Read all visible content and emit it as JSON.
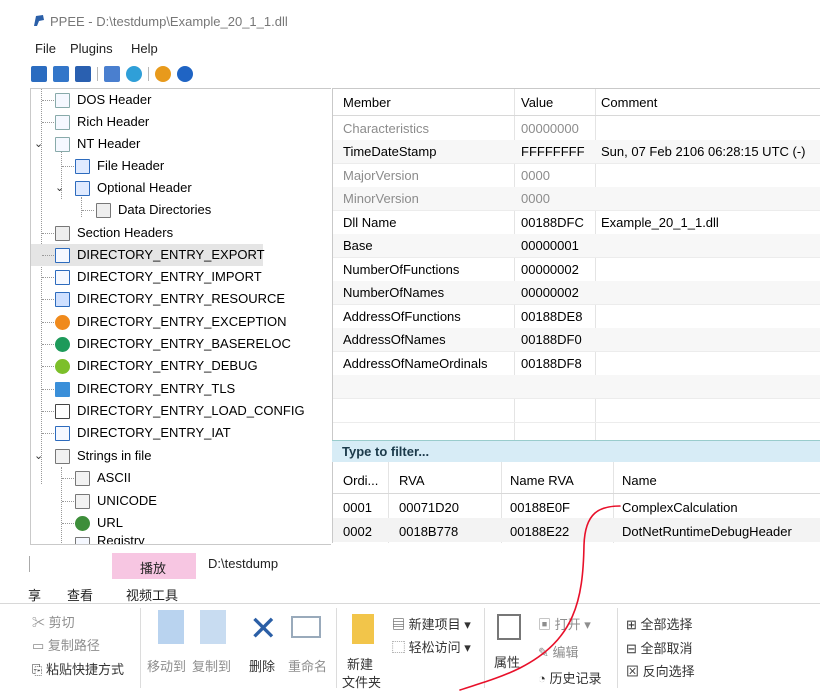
{
  "window": {
    "title": "PPEE - D:\\testdump\\Example_20_1_1.dll"
  },
  "menu": [
    "File",
    "Plugins",
    "Help"
  ],
  "toolbar_icons": [
    "open-folder-icon",
    "save-icon",
    "save-all-icon",
    "hex-icon",
    "refresh-icon",
    "plugin-icon",
    "help-icon"
  ],
  "tree": {
    "items": [
      {
        "label": "DOS Header",
        "icon": "document-icon"
      },
      {
        "label": "Rich Header",
        "icon": "document-icon"
      },
      {
        "label": "NT Header",
        "icon": "document-icon",
        "expanded": true
      },
      {
        "label": "File Header",
        "icon": "table-icon"
      },
      {
        "label": "Optional Header",
        "icon": "table-icon",
        "expanded": true
      },
      {
        "label": "Data Directories",
        "icon": "grid-icon"
      },
      {
        "label": "Section Headers",
        "icon": "grid-icon"
      },
      {
        "label": "DIRECTORY_ENTRY_EXPORT",
        "icon": "export-icon",
        "selected": true
      },
      {
        "label": "DIRECTORY_ENTRY_IMPORT",
        "icon": "import-icon"
      },
      {
        "label": "DIRECTORY_ENTRY_RESOURCE",
        "icon": "resource-icon"
      },
      {
        "label": "DIRECTORY_ENTRY_EXCEPTION",
        "icon": "exception-icon"
      },
      {
        "label": "DIRECTORY_ENTRY_BASERELOC",
        "icon": "reloc-icon"
      },
      {
        "label": "DIRECTORY_ENTRY_DEBUG",
        "icon": "bug-icon"
      },
      {
        "label": "DIRECTORY_ENTRY_TLS",
        "icon": "tls-icon"
      },
      {
        "label": "DIRECTORY_ENTRY_LOAD_CONFIG",
        "icon": "config-icon"
      },
      {
        "label": "DIRECTORY_ENTRY_IAT",
        "icon": "iat-icon"
      },
      {
        "label": "Strings in file",
        "icon": "strings-icon",
        "expanded": true
      },
      {
        "label": "ASCII",
        "icon": "strings-icon"
      },
      {
        "label": "UNICODE",
        "icon": "strings-icon"
      },
      {
        "label": "URL",
        "icon": "globe-icon"
      },
      {
        "label": "Registry",
        "icon": "registry-icon"
      }
    ]
  },
  "members": {
    "headers": [
      "Member",
      "Value",
      "Comment"
    ],
    "rows": [
      {
        "member": "Characteristics",
        "value": "00000000",
        "comment": "",
        "dim": true
      },
      {
        "member": "TimeDateStamp",
        "value": "FFFFFFFF",
        "comment": "Sun, 07 Feb 2106 06:28:15 UTC (-)",
        "dim": false
      },
      {
        "member": "MajorVersion",
        "value": "0000",
        "comment": "",
        "dim": true
      },
      {
        "member": "MinorVersion",
        "value": "0000",
        "comment": "",
        "dim": true
      },
      {
        "member": "Dll Name",
        "value": "00188DFC",
        "comment": "Example_20_1_1.dll",
        "dim": false
      },
      {
        "member": "Base",
        "value": "00000001",
        "comment": "",
        "dim": false
      },
      {
        "member": "NumberOfFunctions",
        "value": "00000002",
        "comment": "",
        "dim": false
      },
      {
        "member": "NumberOfNames",
        "value": "00000002",
        "comment": "",
        "dim": false
      },
      {
        "member": "AddressOfFunctions",
        "value": "00188DE8",
        "comment": "",
        "dim": false
      },
      {
        "member": "AddressOfNames",
        "value": "00188DF0",
        "comment": "",
        "dim": false
      },
      {
        "member": "AddressOfNameOrdinals",
        "value": "00188DF8",
        "comment": "",
        "dim": false
      }
    ]
  },
  "filter": {
    "placeholder": "Type to filter..."
  },
  "exports": {
    "headers": [
      "Ordi...",
      "RVA",
      "Name RVA",
      "Name"
    ],
    "rows": [
      {
        "ordinal": "0001",
        "rva": "00071D20",
        "name_rva": "00188E0F",
        "name": "ComplexCalculation"
      },
      {
        "ordinal": "0002",
        "rva": "0018B778",
        "name_rva": "00188E22",
        "name": "DotNetRuntimeDebugHeader"
      }
    ]
  },
  "ribbon": {
    "context_tab": "播放",
    "path": "D:\\testdump",
    "tabs": [
      "享",
      "查看",
      "视频工具"
    ],
    "clipboard": [
      "剪切",
      "复制路径",
      "粘贴快捷方式"
    ],
    "organize": [
      "移动到",
      "复制到",
      "删除",
      "重命名"
    ],
    "new": {
      "folder": "新建",
      "folder2": "文件夹",
      "item": "新建项目",
      "access": "轻松访问"
    },
    "open": {
      "props": "属性",
      "open": "打开",
      "edit": "编辑",
      "history": "历史记录"
    },
    "select": [
      "全部选择",
      "全部取消",
      "反向选择"
    ]
  },
  "colors": {
    "accent": "#1e7ac8",
    "selection": "#e5e5e5",
    "filter_bg": "#d7ecf6",
    "tab_pink": "#f7c6e2",
    "annotation": "#e8102a"
  }
}
